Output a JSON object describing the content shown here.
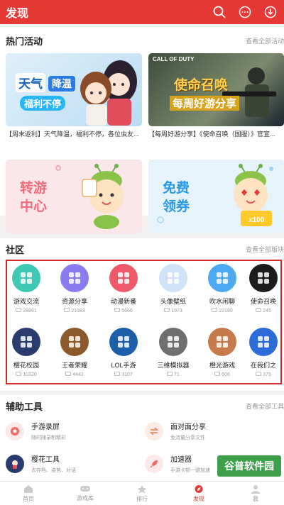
{
  "header": {
    "title": "发现"
  },
  "activities": {
    "title": "热门活动",
    "more": "查看全部活动",
    "banners": [
      {
        "texts": [
          "天气",
          "降温",
          "福利不停"
        ],
        "caption": "【周末返利】天气降温，福利不停，各位虫友..."
      },
      {
        "texts": [
          "CALL OF DUTY",
          "使命召唤",
          "每周好游分享"
        ],
        "caption": "【每周好游分享】《使命召唤（国服）》官宣..."
      },
      {
        "texts": [
          "转游",
          "中心"
        ]
      },
      {
        "texts": [
          "免费",
          "领券",
          "x100"
        ]
      }
    ]
  },
  "community": {
    "title": "社区",
    "more": "查看全部版块",
    "items": [
      {
        "name": "游戏交流",
        "count": "28861",
        "color": "#3dc9b3"
      },
      {
        "name": "资源分享",
        "count": "21083",
        "color": "#8a7cf0"
      },
      {
        "name": "动漫新番",
        "count": "5666",
        "color": "#ef5a6a"
      },
      {
        "name": "头像壁纸",
        "count": "1973",
        "color": "#cfe2f7"
      },
      {
        "name": "吹水闲聊",
        "count": "22180",
        "color": "#4fa9f2"
      },
      {
        "name": "使命召唤",
        "count": "245",
        "color": "#1c1c1c"
      },
      {
        "name": "樱花校园",
        "count": "10320",
        "color": "#2a3b6e"
      },
      {
        "name": "王者荣耀",
        "count": "4442",
        "color": "#8c5a2a"
      },
      {
        "name": "LOL手游",
        "count": "3107",
        "color": "#1d5fa8"
      },
      {
        "name": "三维模拟器",
        "count": "71",
        "color": "#6f6f6f"
      },
      {
        "name": "橙光游戏",
        "count": "606",
        "color": "#c87b4a"
      },
      {
        "name": "在我们之",
        "count": "375",
        "color": "#2d6bd8"
      }
    ]
  },
  "tools": {
    "title": "辅助工具",
    "more": "查看全部工具",
    "items": [
      {
        "name": "手游录屏",
        "desc": "随时随录制精彩",
        "color": "#ef6a6a"
      },
      {
        "name": "面对面分享",
        "desc": "免流量分享文件",
        "color": "#f08a6a"
      },
      {
        "name": "樱花工具",
        "desc": "去存档、姿势、对话",
        "color": "#e88aa8"
      },
      {
        "name": "加速器",
        "desc": "手游卡顿一键加速",
        "color": "#ef6a6a"
      }
    ]
  },
  "nav": [
    {
      "label": "首页",
      "active": false
    },
    {
      "label": "游戏库",
      "active": false
    },
    {
      "label": "排行",
      "active": false
    },
    {
      "label": "发现",
      "active": true
    },
    {
      "label": "我",
      "active": false
    }
  ],
  "watermark": "谷普软件园"
}
